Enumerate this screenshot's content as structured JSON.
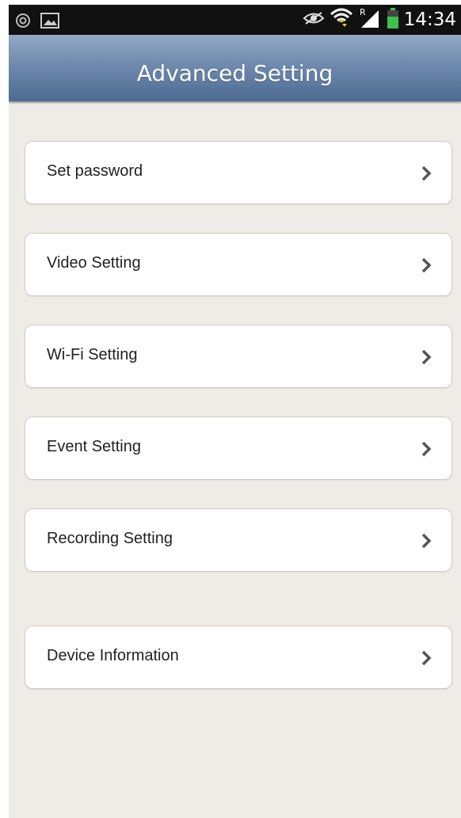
{
  "status_bar": {
    "time": "14:34",
    "left_icons": [
      "notification-icon",
      "image-icon"
    ],
    "right_icons": [
      "eye-icon",
      "wifi-icon",
      "signal-icon",
      "battery-icon"
    ],
    "roaming_indicator": "R"
  },
  "header": {
    "title": "Advanced Setting"
  },
  "menu": {
    "items": [
      {
        "label": "Set password",
        "icon": "chevron-right-icon"
      },
      {
        "label": "Video Setting",
        "icon": "chevron-right-icon"
      },
      {
        "label": "Wi-Fi Setting",
        "icon": "chevron-right-icon"
      },
      {
        "label": "Event Setting",
        "icon": "chevron-right-icon"
      },
      {
        "label": "Recording Setting",
        "icon": "chevron-right-icon"
      },
      {
        "label": "Device Information",
        "icon": "chevron-right-icon"
      }
    ]
  },
  "colors": {
    "background": "#efebe6",
    "title_bar_top": "#93a9c6",
    "title_bar_bottom": "#4c6a92",
    "status_bar": "#111111",
    "battery": "#3cc24a",
    "wifi_arrows": "#f0c419"
  }
}
